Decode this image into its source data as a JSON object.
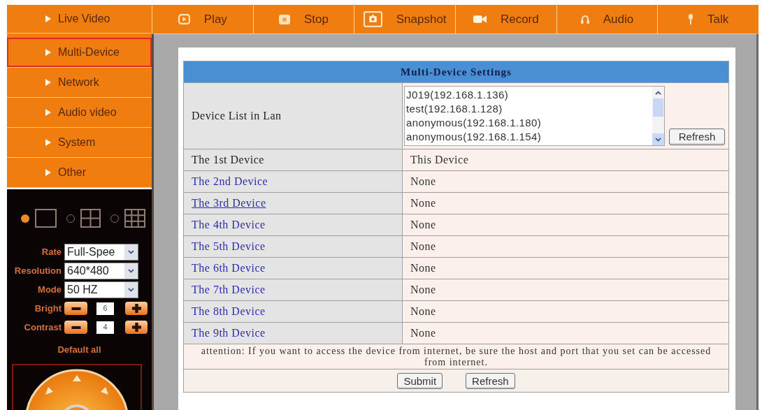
{
  "sidebar": {
    "items": [
      {
        "label": "Live Video",
        "selected": false
      },
      {
        "label": "Multi-Device",
        "selected": true
      },
      {
        "label": "Network",
        "selected": false
      },
      {
        "label": "Audio video",
        "selected": false
      },
      {
        "label": "System",
        "selected": false
      },
      {
        "label": "Other",
        "selected": false
      }
    ]
  },
  "toolbar": {
    "buttons": [
      "Play",
      "Stop",
      "Snapshot",
      "Record",
      "Audio",
      "Talk"
    ]
  },
  "control_panel": {
    "layouts": [
      {
        "selected": true
      },
      {
        "selected": false
      },
      {
        "selected": false
      }
    ],
    "fields": [
      {
        "kind": "select",
        "label": "Rate",
        "value": "Full-Spee"
      },
      {
        "kind": "select",
        "label": "Resolution",
        "value": "640*480"
      },
      {
        "kind": "select",
        "label": "Mode",
        "value": "50 HZ"
      },
      {
        "kind": "stepper",
        "label": "Bright",
        "value": "6"
      },
      {
        "kind": "stepper",
        "label": "Contrast",
        "value": "4"
      }
    ],
    "reset_link": "Default all"
  },
  "settings": {
    "title": "Multi-Device Settings",
    "device_list": {
      "label": "Device List in Lan",
      "items": [
        "J019(192.168.1.136)",
        "test(192.168.1.128)",
        "anonymous(192.168.1.180)",
        "anonymous(192.168.1.154)"
      ],
      "button": "Refresh"
    },
    "devices": [
      {
        "kind": "text",
        "label": "The 1st Device",
        "value": "This Device",
        "hovered": false
      },
      {
        "kind": "link",
        "label": "The 2nd Device",
        "value": "None",
        "hovered": false
      },
      {
        "kind": "link",
        "label": "The 3rd Device",
        "value": "None",
        "hovered": true
      },
      {
        "kind": "link",
        "label": "The 4th Device",
        "value": "None",
        "hovered": false
      },
      {
        "kind": "link",
        "label": "The 5th Device",
        "value": "None",
        "hovered": false
      },
      {
        "kind": "link",
        "label": "The 6th Device",
        "value": "None",
        "hovered": false
      },
      {
        "kind": "link",
        "label": "The 7th Device",
        "value": "None",
        "hovered": false
      },
      {
        "kind": "link",
        "label": "The 8th Device",
        "value": "None",
        "hovered": false
      },
      {
        "kind": "link",
        "label": "The 9th Device",
        "value": "None",
        "hovered": false
      }
    ],
    "notice": "attention: If you want to access the device from internet, be sure the host and port that you set can be accessed from internet.",
    "buttons": [
      "Submit",
      "Refresh"
    ]
  }
}
